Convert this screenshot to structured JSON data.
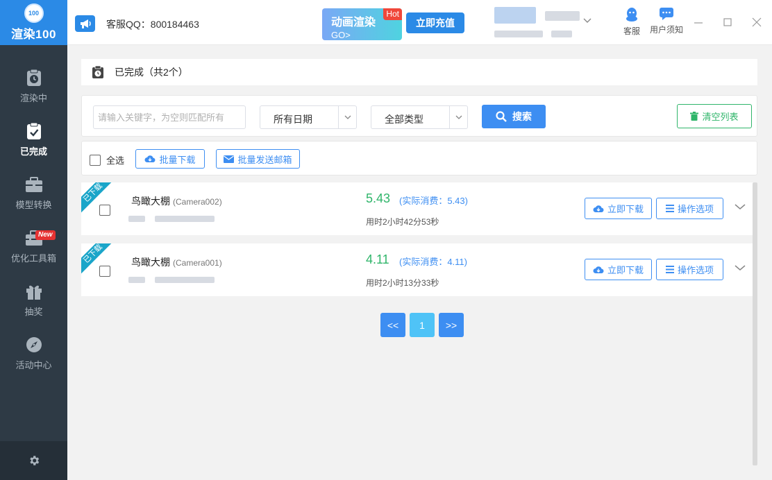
{
  "sidebar": {
    "logo_num": "100",
    "logo_text": "渲染100",
    "items": [
      {
        "label": "渲染中",
        "icon": "clipboard-clock-icon"
      },
      {
        "label": "已完成",
        "icon": "clipboard-check-icon"
      },
      {
        "label": "模型转换",
        "icon": "briefcase-icon"
      },
      {
        "label": "优化工具箱",
        "icon": "toolbox-icon"
      },
      {
        "label": "抽奖",
        "icon": "gift-icon"
      },
      {
        "label": "活动中心",
        "icon": "compass-icon"
      }
    ],
    "new_badge": "New",
    "active_index": 1,
    "settings_icon": "gear-icon"
  },
  "header": {
    "qq_label": "客服QQ：800184463",
    "promo_title": "动画渲染",
    "promo_go": "GO>",
    "hot_badge": "Hot",
    "recharge_label": "立即充值",
    "support_label": "客服",
    "notice_label": "用户须知"
  },
  "page": {
    "title": "已完成（共2个）"
  },
  "filters": {
    "search_placeholder": "请输入关键字，为空则匹配所有",
    "date_select": "所有日期",
    "type_select": "全部类型",
    "search_label": "搜索",
    "clear_label": "清空列表"
  },
  "actions": {
    "select_all": "全选",
    "batch_download": "批量下载",
    "batch_email": "批量发送邮箱"
  },
  "tasks": [
    {
      "badge": "已下载",
      "name": "鸟瞰大棚",
      "camera": "(Camera002)",
      "price": "5.43",
      "actual": "(实际消费：5.43)",
      "time": "用时2小时42分53秒",
      "download": "立即下载",
      "options": "操作选项"
    },
    {
      "badge": "已下载",
      "name": "鸟瞰大棚",
      "camera": "(Camera001)",
      "price": "4.11",
      "actual": "(实际消费：4.11)",
      "time": "用时2小时13分33秒",
      "download": "立即下载",
      "options": "操作选项"
    }
  ],
  "pagination": {
    "prev": "<<",
    "current": "1",
    "next": ">>"
  },
  "colors": {
    "brand": "#2b8ae6",
    "success": "#2fb56a",
    "sidebar_bg": "#2e3a45"
  }
}
